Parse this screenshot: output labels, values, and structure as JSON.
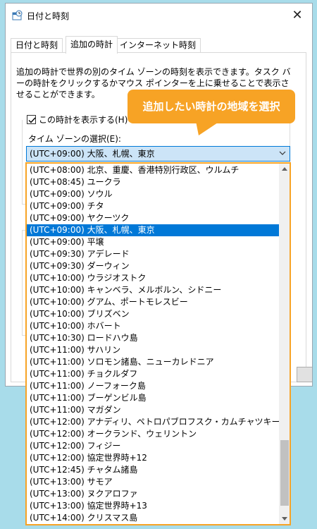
{
  "window": {
    "title": "日付と時刻",
    "close_label": "✕"
  },
  "tabs": [
    {
      "label": "日付と時刻",
      "active": false
    },
    {
      "label": "追加の時計",
      "active": true
    },
    {
      "label": "インターネット時刻",
      "active": false
    }
  ],
  "description": "追加の時計で世界の別のタイム ゾーンの時刻を表示できます。タスク バーの時計をクリックするかマウス ポインターを上に乗せることで表示させることができます。",
  "clock1": {
    "show_label": "この時計を表示する(H)",
    "checked": true,
    "timezone_label": "タイム ゾーンの選択(E):",
    "timezone_value": "(UTC+09:00) 大阪、札幌、東京"
  },
  "callout": {
    "text": "追加したい時計の地域を選択"
  },
  "dropdown": {
    "items": [
      "(UTC+08:00) 北京、重慶、香港特別行政区、ウルムチ",
      "(UTC+08:45) ユークラ",
      "(UTC+09:00) ソウル",
      "(UTC+09:00) チタ",
      "(UTC+09:00) ヤクーツク",
      "(UTC+09:00) 大阪、札幌、東京",
      "(UTC+09:00) 平壌",
      "(UTC+09:30) アデレード",
      "(UTC+09:30) ダーウィン",
      "(UTC+10:00) ウラジオストク",
      "(UTC+10:00) キャンベラ、メルボルン、シドニー",
      "(UTC+10:00) グアム、ポートモレスビー",
      "(UTC+10:00) ブリズベン",
      "(UTC+10:00) ホバート",
      "(UTC+10:30) ロードハウ島",
      "(UTC+11:00) サハリン",
      "(UTC+11:00) ソロモン諸島、ニューカレドニア",
      "(UTC+11:00) チョクルダフ",
      "(UTC+11:00) ノーフォーク島",
      "(UTC+11:00) ブーゲンビル島",
      "(UTC+11:00) マガダン",
      "(UTC+12:00) アナディリ、ペトロパブロフスク・カムチャツキー",
      "(UTC+12:00) オークランド、ウェリントン",
      "(UTC+12:00) フィジー",
      "(UTC+12:00) 協定世界時+12",
      "(UTC+12:45) チャタム諸島",
      "(UTC+13:00) サモア",
      "(UTC+13:00) ヌクアロファ",
      "(UTC+13:00) 協定世界時+13",
      "(UTC+14:00) クリスマス島"
    ],
    "selected_index": 5
  },
  "colors": {
    "accent": "#0078d7",
    "callout": "#f7a325",
    "background": "#a8dcea"
  }
}
